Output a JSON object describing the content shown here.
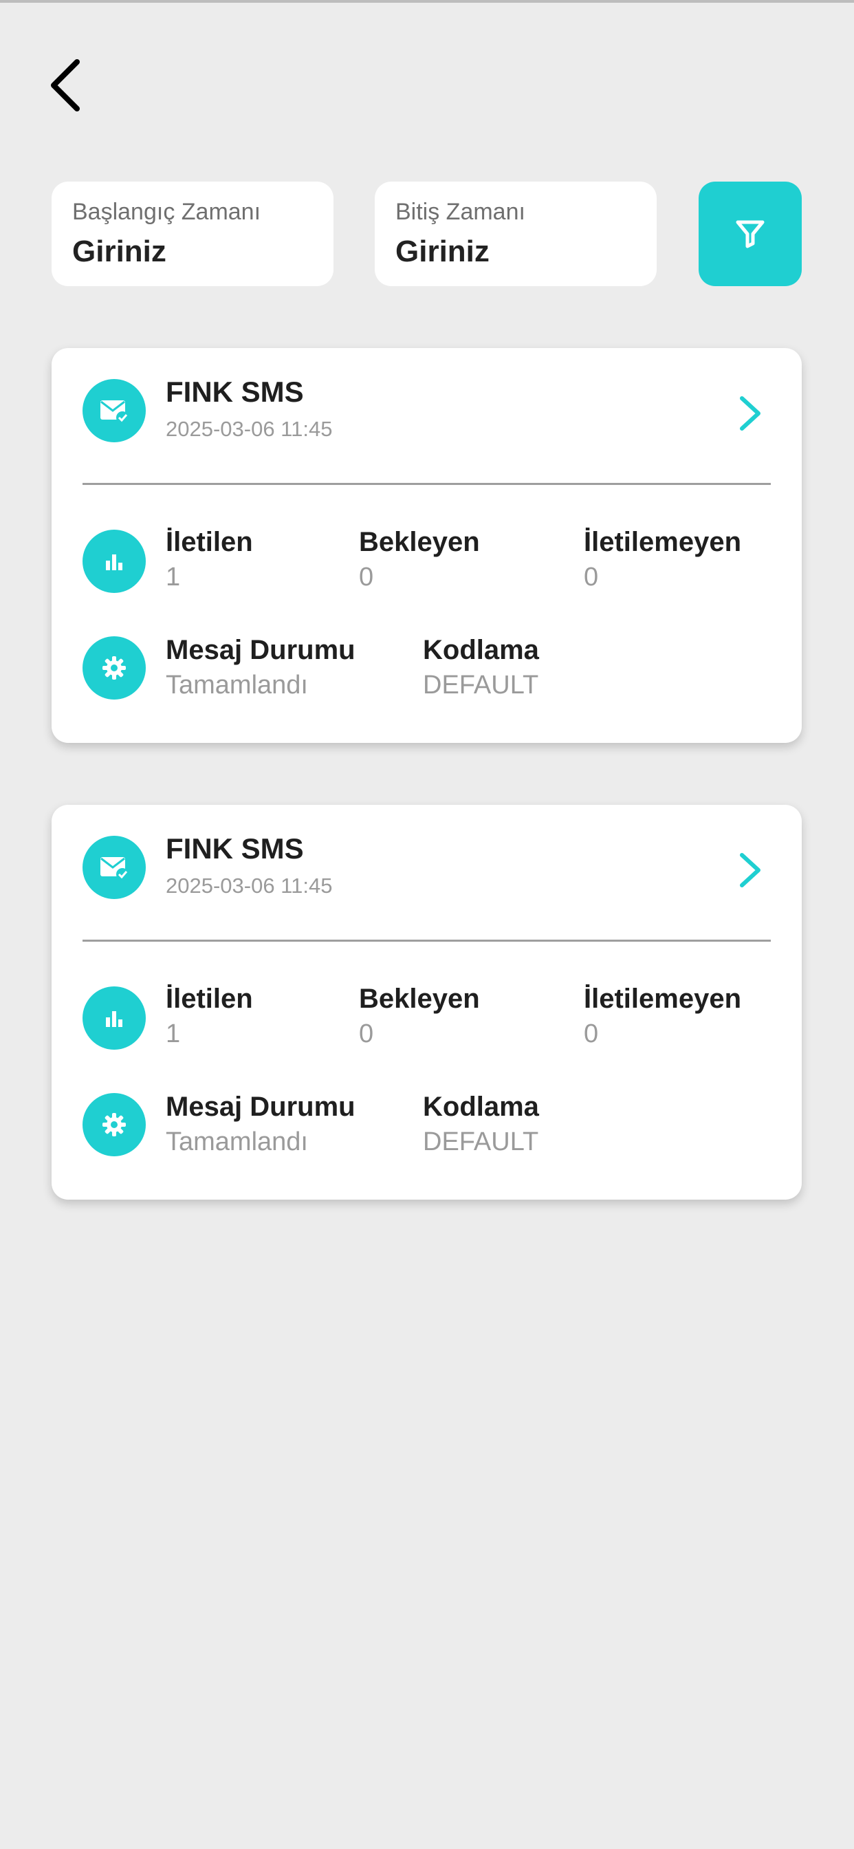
{
  "filters": {
    "start": {
      "label": "Başlangıç Zamanı",
      "value": "Giriniz"
    },
    "end": {
      "label": "Bitiş Zamanı",
      "value": "Giriniz"
    }
  },
  "icons": {
    "back": "chevron-left-icon",
    "filter": "filter-funnel-icon",
    "message": "mail-check-icon",
    "stats": "bar-chart-icon",
    "settings": "gear-icon",
    "detail": "chevron-right-icon"
  },
  "colors": {
    "accent": "#1fcfd1",
    "background": "#ececec"
  },
  "cards": [
    {
      "title": "FINK SMS",
      "date": "2025-03-06 11:45",
      "stats": [
        {
          "label": "İletilen",
          "value": "1"
        },
        {
          "label": "Bekleyen",
          "value": "0"
        },
        {
          "label": "İletilemeyen",
          "value": "0"
        }
      ],
      "status": {
        "label": "Mesaj Durumu",
        "value": "Tamamlandı"
      },
      "encoding": {
        "label": "Kodlama",
        "value": "DEFAULT"
      }
    },
    {
      "title": "FINK SMS",
      "date": "2025-03-06 11:45",
      "stats": [
        {
          "label": "İletilen",
          "value": "1"
        },
        {
          "label": "Bekleyen",
          "value": "0"
        },
        {
          "label": "İletilemeyen",
          "value": "0"
        }
      ],
      "status": {
        "label": "Mesaj Durumu",
        "value": "Tamamlandı"
      },
      "encoding": {
        "label": "Kodlama",
        "value": "DEFAULT"
      }
    }
  ]
}
